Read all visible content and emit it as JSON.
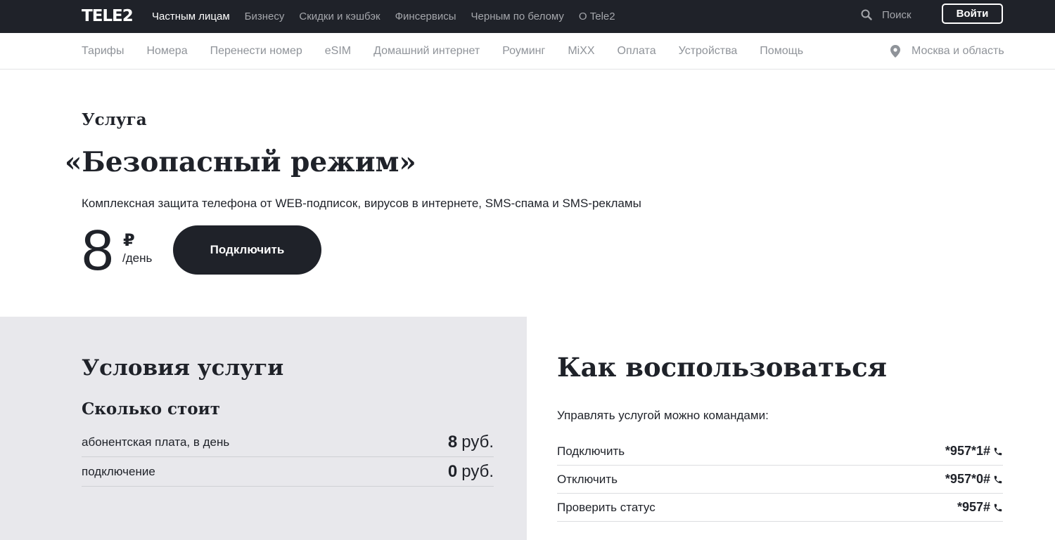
{
  "topbar": {
    "logo": "TELE2",
    "nav": [
      "Частным лицам",
      "Бизнесу",
      "Скидки и кэшбэк",
      "Финсервисы",
      "Черным по белому",
      "О Tele2"
    ],
    "search_label": "Поиск",
    "login_label": "Войти"
  },
  "subnav": {
    "items": [
      "Тарифы",
      "Номера",
      "Перенести номер",
      "eSIM",
      "Домашний интернет",
      "Роуминг",
      "MiXX",
      "Оплата",
      "Устройства",
      "Помощь"
    ],
    "region": "Москва и область"
  },
  "hero": {
    "label": "Услуга",
    "title": "«Безопасный режим»",
    "description": "Комплексная защита телефона от WEB-подписок, вирусов в интернете, SMS-спама и SMS-рекламы",
    "price": "8",
    "currency": "₽",
    "period": "/день",
    "connect_label": "Подключить"
  },
  "conditions": {
    "title": "Условия услуги",
    "cost_title": "Сколько стоит",
    "rows": [
      {
        "label": "абонентская плата, в день",
        "value": "8",
        "unit": "руб."
      },
      {
        "label": "подключение",
        "value": "0",
        "unit": "руб."
      }
    ]
  },
  "howto": {
    "title": "Как воспользоваться",
    "intro": "Управлять услугой можно командами:",
    "commands": [
      {
        "label": "Подключить",
        "code": "*957*1#"
      },
      {
        "label": "Отключить",
        "code": "*957*0#"
      },
      {
        "label": "Проверить статус",
        "code": "*957#"
      }
    ]
  },
  "colors": {
    "dark": "#1f2229",
    "panel": "#e8e8ec",
    "muted": "#8f9399"
  }
}
